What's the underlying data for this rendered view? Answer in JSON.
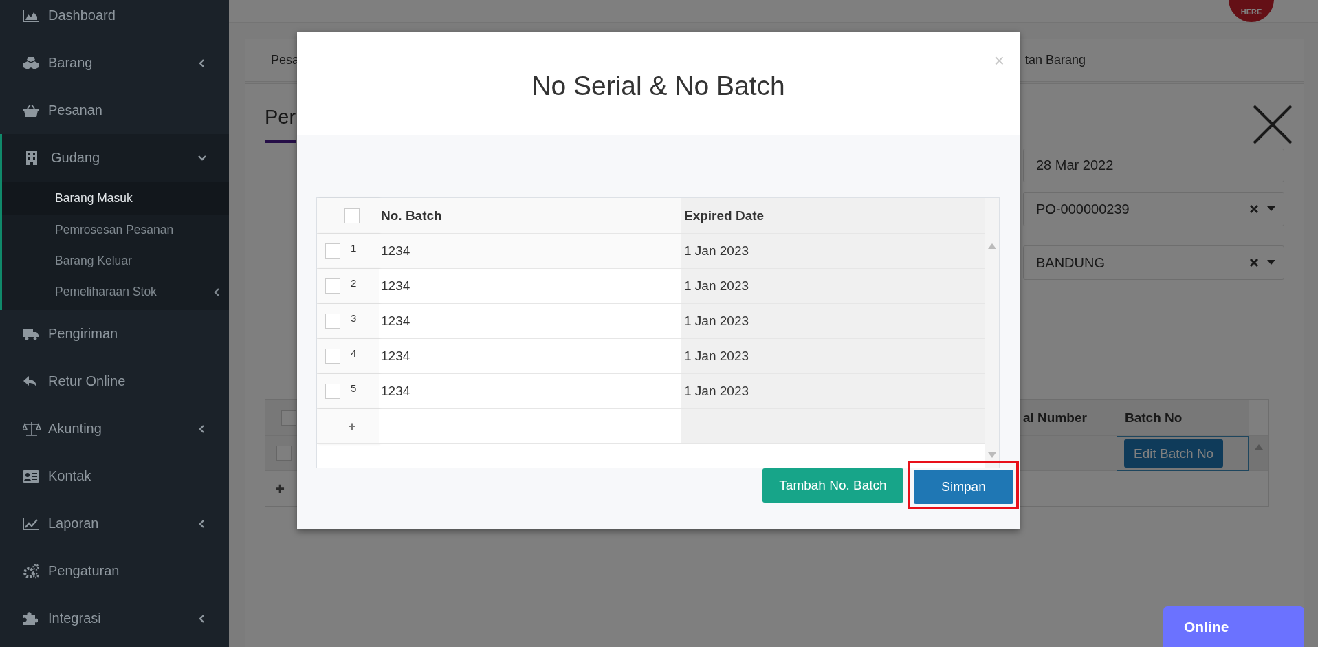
{
  "sidebar": {
    "items": [
      {
        "label": "Dashboard",
        "selected": false
      },
      {
        "label": "Barang",
        "selected": false,
        "expanded": false
      },
      {
        "label": "Pesanan",
        "selected": false
      },
      {
        "label": "Gudang",
        "selected": false,
        "expanded": true,
        "children": [
          {
            "label": "Barang Masuk",
            "selected": true
          },
          {
            "label": "Pemrosesan Pesanan",
            "selected": false
          },
          {
            "label": "Barang Keluar",
            "selected": false
          },
          {
            "label": "Pemeliharaan Stok",
            "selected": false,
            "expanded": false
          }
        ]
      },
      {
        "label": "Pengiriman",
        "selected": false
      },
      {
        "label": "Retur Online",
        "selected": false
      },
      {
        "label": "Akunting",
        "selected": false,
        "expanded": false
      },
      {
        "label": "Kontak",
        "selected": false
      },
      {
        "label": "Laporan",
        "selected": false,
        "expanded": false
      },
      {
        "label": "Pengaturan",
        "selected": false
      },
      {
        "label": "Integrasi",
        "selected": false,
        "expanded": false
      }
    ]
  },
  "header": {
    "logo_text": "HERE"
  },
  "tabs": [
    {
      "label": "Pesa"
    },
    {
      "label": "tan Barang"
    }
  ],
  "page": {
    "title": "Per",
    "fields": [
      {
        "kind": "date",
        "value": "28 Mar 2022"
      },
      {
        "kind": "select",
        "value": "PO-000000239"
      },
      {
        "kind": "select",
        "value": "BANDUNG"
      }
    ],
    "items_table": {
      "columns": [
        "al Number",
        "Batch No"
      ],
      "all_checked": false,
      "rows": [
        {
          "checked": false,
          "action": "Edit Batch No"
        }
      ],
      "add_row": "+"
    }
  },
  "modal": {
    "title": "No Serial & No Batch",
    "close": "×",
    "table": {
      "columns": [
        "No. Batch",
        "Expired Date"
      ],
      "all_checked": false,
      "add_row": "+",
      "rows": [
        {
          "number": "1",
          "batch": "1234",
          "expired": "1 Jan 2023",
          "checked": false
        },
        {
          "number": "2",
          "batch": "1234",
          "expired": "1 Jan 2023",
          "checked": false
        },
        {
          "number": "3",
          "batch": "1234",
          "expired": "1 Jan 2023",
          "checked": false
        },
        {
          "number": "4",
          "batch": "1234",
          "expired": "1 Jan 2023",
          "checked": false
        },
        {
          "number": "5",
          "batch": "1234",
          "expired": "1 Jan 2023",
          "checked": false
        }
      ]
    },
    "buttons": [
      {
        "label": "Tambah No. Batch",
        "kind": "success",
        "highlighted": false
      },
      {
        "label": "Simpan",
        "kind": "primary",
        "highlighted": true
      }
    ]
  },
  "status_button": {
    "label": "Online"
  }
}
